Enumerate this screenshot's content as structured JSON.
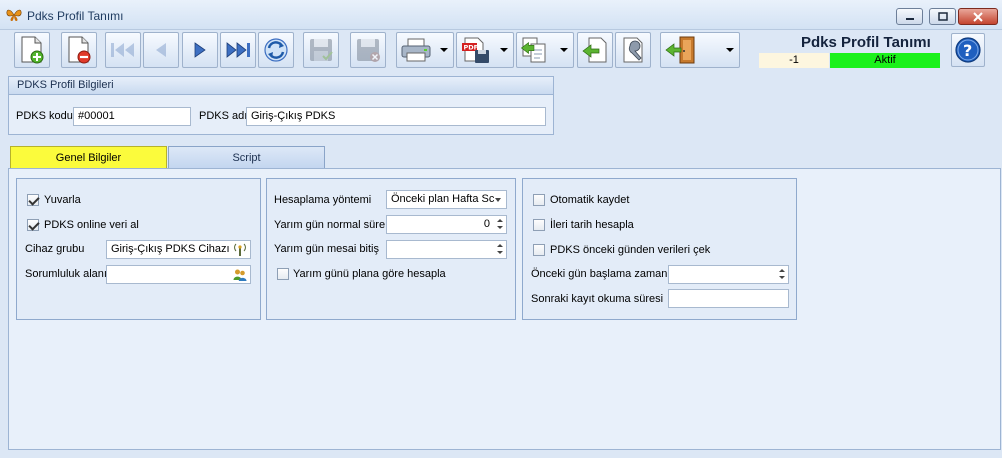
{
  "window": {
    "title": "Pdks Profil Tanımı"
  },
  "toolbar": {
    "new": "new-document-icon",
    "delete": "delete-document-icon",
    "first": "first-record-icon",
    "prev": "previous-record-icon",
    "next": "next-record-icon",
    "last": "last-record-icon",
    "refresh": "refresh-icon",
    "save": "save-icon",
    "cancel": "cancel-save-icon",
    "print": "printer-icon",
    "pdf": "pdf-export-icon",
    "copy": "copy-icon",
    "import": "import-icon",
    "tools": "tools-icon",
    "exit": "exit-door-icon"
  },
  "header": {
    "title": "Pdks Profil Tanımı",
    "record_no": "-1",
    "status": "Aktif",
    "status_color": "#1bf11b"
  },
  "group": {
    "title": "PDKS Profil Bilgileri",
    "code_label": "PDKS kodu",
    "code_value": "#00001",
    "name_label": "PDKS adı",
    "name_value": "Giriş-Çıkış PDKS"
  },
  "tabs": [
    {
      "label": "Genel Bilgiler",
      "active": true
    },
    {
      "label": "Script",
      "active": false
    }
  ],
  "panel1": {
    "round_label": "Yuvarla",
    "round_checked": true,
    "online_label": "PDKS online veri al",
    "online_checked": true,
    "device_group_label": "Cihaz grubu",
    "device_group_value": "Giriş-Çıkış PDKS Cihazı",
    "responsibility_label": "Sorumluluk alanı",
    "responsibility_value": ""
  },
  "panel2": {
    "method_label": "Hesaplama yöntemi",
    "method_value": "Önceki plan Hafta Sc",
    "half_normal_label": "Yarım gün normal süre",
    "half_normal_value": "0",
    "half_end_label": "Yarım gün mesai bitiş",
    "half_end_value": "",
    "half_plan_label": "Yarım günü plana göre hesapla",
    "half_plan_checked": false
  },
  "panel3": {
    "autosave_label": "Otomatik kaydet",
    "autosave_checked": false,
    "future_label": "İleri tarih hesapla",
    "future_checked": false,
    "prevday_label": "PDKS önceki günden verileri çek",
    "prevday_checked": false,
    "prev_start_label": "Önceki gün başlama zamanı",
    "prev_start_value": "",
    "next_read_label": "Sonraki kayıt okuma süresi",
    "next_read_value": ""
  }
}
